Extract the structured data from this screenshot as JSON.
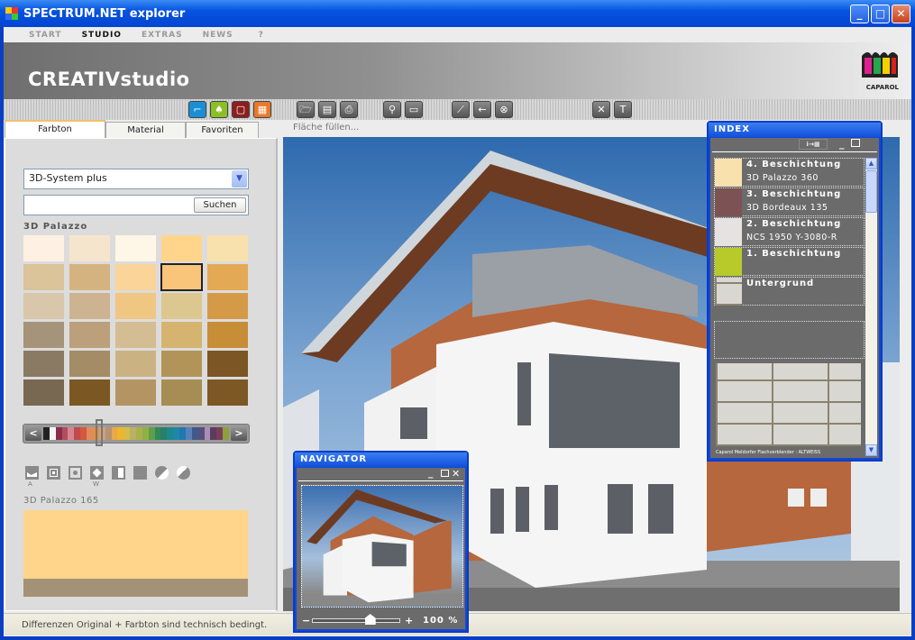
{
  "window": {
    "title": "SPECTRUM.NET explorer",
    "controls": {
      "minimize": "_",
      "maximize": "□",
      "close": "✕"
    }
  },
  "menu": {
    "items": [
      "START",
      "STUDIO",
      "EXTRAS",
      "NEWS",
      "?"
    ],
    "active": "STUDIO"
  },
  "header": {
    "title": "CREATIVstudio",
    "logo_text": "CAPAROL"
  },
  "toolbar": {
    "buttons": [
      {
        "icon": "area-select-icon",
        "color": "#1b8fd6",
        "glyph": "⌐"
      },
      {
        "icon": "fill-bucket-icon",
        "color": "#8bbf25",
        "glyph": "♠"
      },
      {
        "icon": "3d-box-icon",
        "color": "#8e1e1e",
        "glyph": "▢"
      },
      {
        "icon": "texture-icon",
        "color": "#e8792b",
        "glyph": "▦"
      },
      {
        "icon": "open-folder-icon",
        "glyph": "🗁"
      },
      {
        "icon": "save-icon",
        "glyph": "▤"
      },
      {
        "icon": "print-icon",
        "glyph": "⎙"
      },
      {
        "icon": "zoom-icon",
        "glyph": "⚲"
      },
      {
        "icon": "window-icon",
        "glyph": "▭"
      },
      {
        "icon": "eyedropper-icon",
        "glyph": "⟋"
      },
      {
        "icon": "back-arrow-icon",
        "glyph": "←"
      },
      {
        "icon": "cancel-icon",
        "glyph": "⊗"
      },
      {
        "icon": "clear-icon",
        "glyph": "✕"
      },
      {
        "icon": "text-icon",
        "glyph": "T"
      }
    ]
  },
  "tabs": [
    {
      "label": "Farbton",
      "active": true
    },
    {
      "label": "Material"
    },
    {
      "label": "Favoriten"
    }
  ],
  "hint": "Fläche füllen...",
  "left": {
    "system_select": "3D-System plus",
    "search_value": "",
    "search_button": "Suchen",
    "group_label": "3D Palazzo",
    "swatches": [
      "#fef0e2",
      "#f6e5cd",
      "#fef6e6",
      "#fed58b",
      "#f8e1ac",
      "#dbc39a",
      "#d5b380",
      "#fbd49a",
      "#f9c57b",
      "#e4a955",
      "#d8c7ab",
      "#cdb392",
      "#f0c683",
      "#dcc78f",
      "#d59a48",
      "#a59479",
      "#bba07b",
      "#d4bc93",
      "#d5b46f",
      "#c78d37",
      "#8b7a63",
      "#a38c66",
      "#cbb282",
      "#b39458",
      "#7c5624",
      "#786751",
      "#7b5723",
      "#b59464",
      "#a58d54",
      "#7d5724"
    ],
    "selected_swatch": 8,
    "strip_colors": [
      "#222",
      "#f5f5f5",
      "#8a2d4a",
      "#b34d5c",
      "#d4868f",
      "#c24a4a",
      "#d2583e",
      "#e08a5e",
      "#e88f3f",
      "#c9a383",
      "#b89170",
      "#e9a84a",
      "#f0b62a",
      "#d7bc45",
      "#b9b166",
      "#a9b14b",
      "#8fb043",
      "#5e9e4b",
      "#2f8a58",
      "#2a7e6a",
      "#1a8a8a",
      "#1f86a8",
      "#2078b0",
      "#5a80b8",
      "#3f5a8a",
      "#5a4e7e",
      "#a690b8",
      "#5e3a5e",
      "#7a3e5a",
      "#8da03a"
    ],
    "view_modes": [
      {
        "icon": "image-mode-icon",
        "label": "A"
      },
      {
        "icon": "frame-mode-icon"
      },
      {
        "icon": "dot-mode-icon"
      },
      {
        "icon": "diamond-mode-icon",
        "label": "W"
      },
      {
        "icon": "split-mode-icon"
      },
      {
        "icon": "solid-mode-icon"
      },
      {
        "icon": "half-circle-icon"
      },
      {
        "icon": "half-circle-alt-icon"
      }
    ],
    "color_name": "3D Palazzo 165",
    "preview_color": "#fed58b",
    "preview_base_color": "#a39277"
  },
  "status": "Differenzen Original + Farbton sind technisch bedingt.",
  "index": {
    "title": "INDEX",
    "layers": [
      {
        "title": "4. Beschichtung",
        "subtitle": "3D Palazzo 360",
        "color": "#f8e1ac"
      },
      {
        "title": "3. Beschichtung",
        "subtitle": "3D Bordeaux 135",
        "color": "#7c5254"
      },
      {
        "title": "2. Beschichtung",
        "subtitle": "NCS 1950  Y-3080-R",
        "color": "#e7e2e2"
      },
      {
        "title": "1. Beschichtung",
        "subtitle": "",
        "color": "#b6cb2a"
      },
      {
        "title": "Untergrund",
        "subtitle": "",
        "color": "brick"
      }
    ],
    "material_caption": "Caparol Meldorfer Flachverblender : ALTWEISS"
  },
  "navigator": {
    "title": "NAVIGATOR",
    "zoom": "100 %",
    "zoom_level": 0.65,
    "minus": "−",
    "plus": "+"
  }
}
